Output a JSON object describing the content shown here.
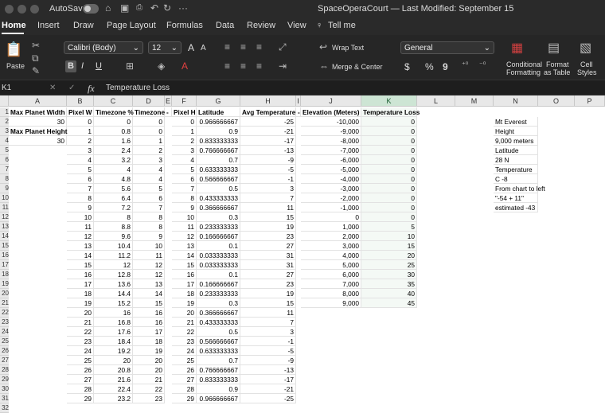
{
  "titlebar": {
    "autosave_label": "AutoSave",
    "toggle_state": "OFF",
    "title": "SpaceOperaCourt — Last Modified: September 15"
  },
  "menu": [
    "Home",
    "Insert",
    "Draw",
    "Page Layout",
    "Formulas",
    "Data",
    "Review",
    "View"
  ],
  "tell_me": "Tell me",
  "ribbon": {
    "paste": "Paste",
    "font": "Calibri (Body)",
    "font_size": "12",
    "font_grow": "A",
    "font_shrink": "A",
    "bold": "B",
    "italic": "I",
    "underline": "U",
    "wrap_text": "Wrap Text",
    "merge_center": "Merge & Center",
    "number_format": "General",
    "currency": "$",
    "percent": "%",
    "comma": "9",
    "conditional_formatting": [
      "Conditional",
      "Formatting"
    ],
    "format_as_table": [
      "Format",
      "as Table"
    ],
    "cell_styles": [
      "Cell",
      "Styles"
    ]
  },
  "formula_bar": {
    "name_box": "K1",
    "fx": "fx",
    "content": "Temperature Loss"
  },
  "columns": [
    "A",
    "B",
    "C",
    "D",
    "E",
    "F",
    "G",
    "H",
    "I",
    "J",
    "K",
    "L",
    "M",
    "N",
    "O",
    "P"
  ],
  "selected_column": "K",
  "rows": [
    "1",
    "2",
    "3",
    "4",
    "5",
    "6",
    "7",
    "8",
    "9",
    "10",
    "11",
    "12",
    "13",
    "14",
    "15",
    "16",
    "17",
    "18",
    "19",
    "20",
    "21",
    "22",
    "23",
    "24",
    "25",
    "26",
    "27",
    "28",
    "29",
    "30",
    "31",
    "32"
  ],
  "headers": {
    "A": "Max Planet Width",
    "B": "Pixel W",
    "C": "Timezone %",
    "D": "Timezone",
    "E": "-",
    "F": "Pixel H",
    "G": "Latitude",
    "H": "Avg Temperature",
    "I": "-",
    "J": "Elevation (Meters)",
    "K": "Temperature Loss"
  },
  "col_a": {
    "A2": "30",
    "A3": "Max Planet Height",
    "A4": "30"
  },
  "col_B": [
    "0",
    "1",
    "2",
    "3",
    "4",
    "5",
    "6",
    "7",
    "8",
    "9",
    "10",
    "11",
    "12",
    "13",
    "14",
    "15",
    "16",
    "17",
    "18",
    "19",
    "20",
    "21",
    "22",
    "23",
    "24",
    "25",
    "26",
    "27",
    "28",
    "29"
  ],
  "col_C": [
    "0",
    "0.8",
    "1.6",
    "2.4",
    "3.2",
    "4",
    "4.8",
    "5.6",
    "6.4",
    "7.2",
    "8",
    "8.8",
    "9.6",
    "10.4",
    "11.2",
    "12",
    "12.8",
    "13.6",
    "14.4",
    "15.2",
    "16",
    "16.8",
    "17.6",
    "18.4",
    "19.2",
    "20",
    "20.8",
    "21.6",
    "22.4",
    "23.2"
  ],
  "col_D": [
    "0",
    "0",
    "1",
    "2",
    "3",
    "4",
    "4",
    "5",
    "6",
    "7",
    "8",
    "8",
    "9",
    "10",
    "11",
    "12",
    "12",
    "13",
    "14",
    "15",
    "16",
    "16",
    "17",
    "18",
    "19",
    "20",
    "20",
    "21",
    "22",
    "23"
  ],
  "col_F": [
    "0",
    "1",
    "2",
    "3",
    "4",
    "5",
    "6",
    "7",
    "8",
    "9",
    "10",
    "11",
    "12",
    "13",
    "14",
    "15",
    "16",
    "17",
    "18",
    "19",
    "20",
    "21",
    "22",
    "23",
    "24",
    "25",
    "26",
    "27",
    "28",
    "29"
  ],
  "col_G": [
    "0.966666667",
    "0.9",
    "0.833333333",
    "0.766666667",
    "0.7",
    "0.633333333",
    "0.566666667",
    "0.5",
    "0.433333333",
    "0.366666667",
    "0.3",
    "0.233333333",
    "0.166666667",
    "0.1",
    "0.033333333",
    "0.033333333",
    "0.1",
    "0.166666667",
    "0.233333333",
    "0.3",
    "0.366666667",
    "0.433333333",
    "0.5",
    "0.566666667",
    "0.633333333",
    "0.7",
    "0.766666667",
    "0.833333333",
    "0.9",
    "0.966666667"
  ],
  "col_H": [
    "-25",
    "-21",
    "-17",
    "-13",
    "-9",
    "-5",
    "-1",
    "3",
    "7",
    "11",
    "15",
    "19",
    "23",
    "27",
    "31",
    "31",
    "27",
    "23",
    "19",
    "15",
    "11",
    "7",
    "3",
    "-1",
    "-5",
    "-9",
    "-13",
    "-17",
    "-21",
    "-25"
  ],
  "col_J": [
    "-10,000",
    "-9,000",
    "-8,000",
    "-7,000",
    "-6,000",
    "-5,000",
    "-4,000",
    "-3,000",
    "-2,000",
    "-1,000",
    "0",
    "1,000",
    "2,000",
    "3,000",
    "4,000",
    "5,000",
    "6,000",
    "7,000",
    "8,000",
    "9,000"
  ],
  "col_K": [
    "0",
    "0",
    "0",
    "0",
    "0",
    "0",
    "0",
    "0",
    "0",
    "0",
    "0",
    "5",
    "10",
    "15",
    "20",
    "25",
    "30",
    "35",
    "40",
    "45"
  ],
  "col_N": [
    "Mt Everest",
    "Height",
    "9,000 meters",
    "Latitude",
    "28 N",
    "Temperature",
    "C -8",
    "From chart to left",
    "\"-54 + 11\"",
    "estimated -43"
  ]
}
